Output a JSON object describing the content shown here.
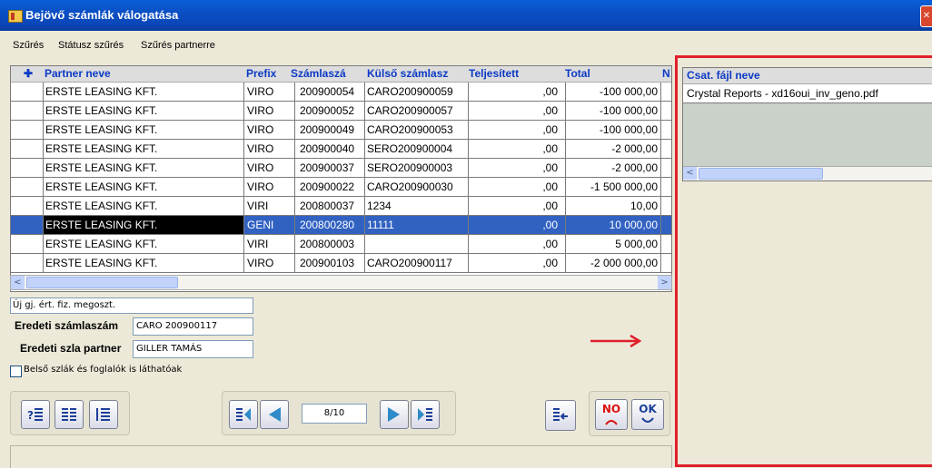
{
  "window": {
    "title": "Bejövő számlák válogatása",
    "close_glyph": "✕"
  },
  "menu": [
    "Szűrés",
    "Státusz szűrés",
    "Szűrés partnerre"
  ],
  "grid": {
    "columns": [
      "✚",
      "Partner neve",
      "Prefix",
      "Számlaszá",
      "Külső számlasz",
      "Teljesített",
      "Total",
      "N"
    ],
    "rows": [
      {
        "partner": "ERSTE LEASING KFT.",
        "prefix": "VIRO",
        "szam": "200900054",
        "kulso": "CARO200900059",
        "telj": ",00",
        "total": "-100 000,00"
      },
      {
        "partner": "ERSTE LEASING KFT.",
        "prefix": "VIRO",
        "szam": "200900052",
        "kulso": "CARO200900057",
        "telj": ",00",
        "total": "-100 000,00"
      },
      {
        "partner": "ERSTE LEASING KFT.",
        "prefix": "VIRO",
        "szam": "200900049",
        "kulso": "CARO200900053",
        "telj": ",00",
        "total": "-100 000,00"
      },
      {
        "partner": "ERSTE LEASING KFT.",
        "prefix": "VIRO",
        "szam": "200900040",
        "kulso": "SERO200900004",
        "telj": ",00",
        "total": "-2 000,00"
      },
      {
        "partner": "ERSTE LEASING KFT.",
        "prefix": "VIRO",
        "szam": "200900037",
        "kulso": "SERO200900003",
        "telj": ",00",
        "total": "-2 000,00"
      },
      {
        "partner": "ERSTE LEASING KFT.",
        "prefix": "VIRO",
        "szam": "200900022",
        "kulso": "CARO200900030",
        "telj": ",00",
        "total": "-1 500 000,00"
      },
      {
        "partner": "ERSTE LEASING KFT.",
        "prefix": "VIRI",
        "szam": "200800037",
        "kulso": "1234",
        "telj": ",00",
        "total": "10,00"
      },
      {
        "partner": "ERSTE LEASING KFT.",
        "prefix": "GENI",
        "szam": "200800280",
        "kulso": "11111",
        "telj": ",00",
        "total": "10 000,00"
      },
      {
        "partner": "ERSTE LEASING KFT.",
        "prefix": "VIRI",
        "szam": "200800003",
        "kulso": "",
        "telj": ",00",
        "total": "5 000,00"
      },
      {
        "partner": "ERSTE LEASING KFT.",
        "prefix": "VIRO",
        "szam": "200900103",
        "kulso": "CARO200900117",
        "telj": ",00",
        "total": "-2 000 000,00"
      }
    ],
    "selected_index": 7,
    "scroll_left": "<",
    "scroll_right": ">"
  },
  "form": {
    "fiz_megoszt": "Új gj. ért. fiz. megoszt.",
    "eredeti_szamlaszam_label": "Eredeti számlaszám",
    "eredeti_szamlaszam_value": "CARO 200900117",
    "eredeti_partner_label": "Eredeti szla partner",
    "eredeti_partner_value": "GILLER TAMÁS",
    "belso_label": "Belső szlák és foglalók is láthatóak"
  },
  "nav": {
    "page": "8/10",
    "no_label": "NO",
    "ok_label": "OK"
  },
  "attachments": {
    "header": "Csat. fájl neve",
    "files": [
      "Crystal Reports - xd16oui_inv_geno.pdf"
    ]
  },
  "arrow_glyph": "→",
  "colors": {
    "title_bar": "#0a4fc4",
    "selection": "#3162c2",
    "highlight": "#e0202b",
    "header_text": "#0c3ac6"
  }
}
